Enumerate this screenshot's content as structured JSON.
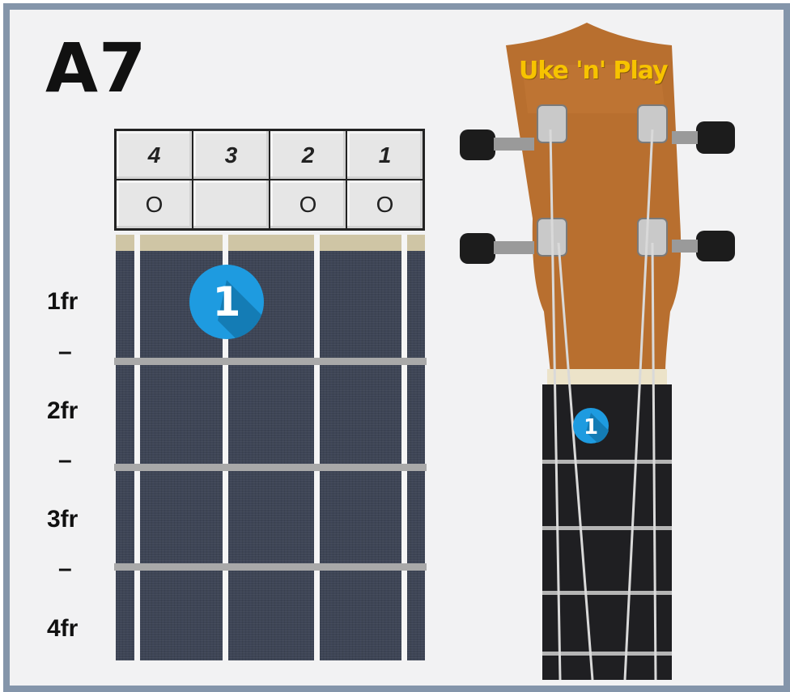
{
  "chord": {
    "name": "A7"
  },
  "strings": {
    "numbers": [
      "4",
      "3",
      "2",
      "1"
    ],
    "open_marks": [
      "O",
      "",
      "O",
      "O"
    ]
  },
  "frets": {
    "labels": [
      "1fr",
      "–",
      "2fr",
      "–",
      "3fr",
      "–",
      "4fr"
    ]
  },
  "finger": {
    "number": "1",
    "string": "3",
    "fret": "1"
  },
  "headstock": {
    "brand": "Uke 'n' Play"
  },
  "colors": {
    "border": "#8495aa",
    "fretboard": "#3e4556",
    "finger_circle": "#1e9be0",
    "brand": "#f7c300",
    "wood": "#b86f2f"
  }
}
